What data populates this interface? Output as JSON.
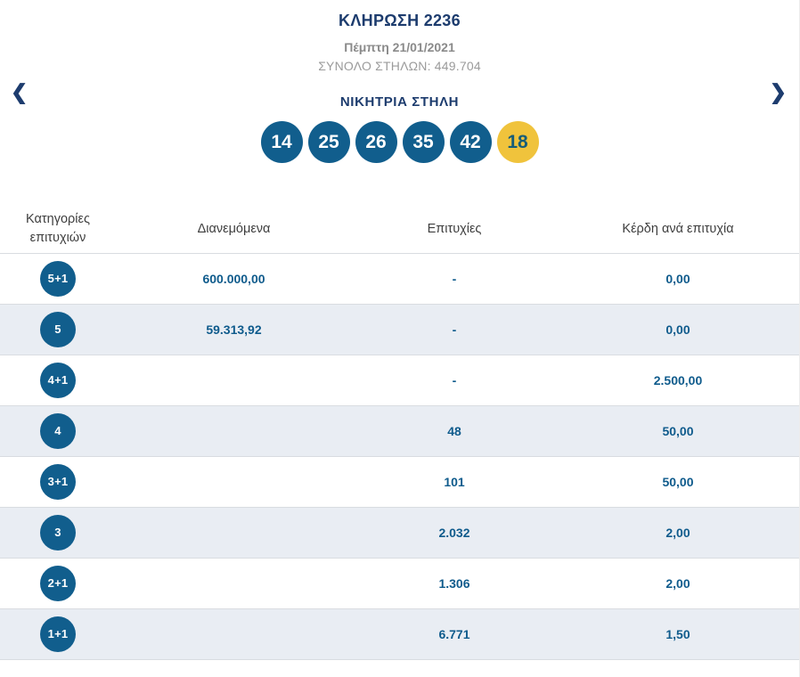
{
  "header": {
    "draw_title": "ΚΛΗΡΩΣΗ 2236",
    "draw_date": "Πέμπτη 21/01/2021",
    "total_columns_label": "ΣΥΝΟΛΟ ΣΤΗΛΩΝ:",
    "total_columns_value": "449.704"
  },
  "nav": {
    "prev_icon": "❮",
    "next_icon": "❯"
  },
  "winning_column": {
    "title": "ΝΙΚΗΤΡΙΑ ΣΤΗΛΗ",
    "numbers": [
      "14",
      "25",
      "26",
      "35",
      "42"
    ],
    "joker": "18"
  },
  "colors": {
    "ball_blue": "#115e8d",
    "joker_yellow": "#f0c33c",
    "joker_text": "#175d78",
    "title_navy": "#1d3c6e",
    "value_blue": "#0f5b8c",
    "alt_row_gray": "#e9edf3"
  },
  "table": {
    "headers": [
      "Κατηγορίες επιτυχιών",
      "Διανεμόμενα",
      "Επιτυχίες",
      "Κέρδη ανά επιτυχία"
    ],
    "rows": [
      {
        "category": "5+1",
        "distributed": "600.000,00",
        "winners": "-",
        "prize": "0,00"
      },
      {
        "category": "5",
        "distributed": "59.313,92",
        "winners": "-",
        "prize": "0,00"
      },
      {
        "category": "4+1",
        "distributed": "",
        "winners": "-",
        "prize": "2.500,00"
      },
      {
        "category": "4",
        "distributed": "",
        "winners": "48",
        "prize": "50,00"
      },
      {
        "category": "3+1",
        "distributed": "",
        "winners": "101",
        "prize": "50,00"
      },
      {
        "category": "3",
        "distributed": "",
        "winners": "2.032",
        "prize": "2,00"
      },
      {
        "category": "2+1",
        "distributed": "",
        "winners": "1.306",
        "prize": "2,00"
      },
      {
        "category": "1+1",
        "distributed": "",
        "winners": "6.771",
        "prize": "1,50"
      }
    ]
  }
}
